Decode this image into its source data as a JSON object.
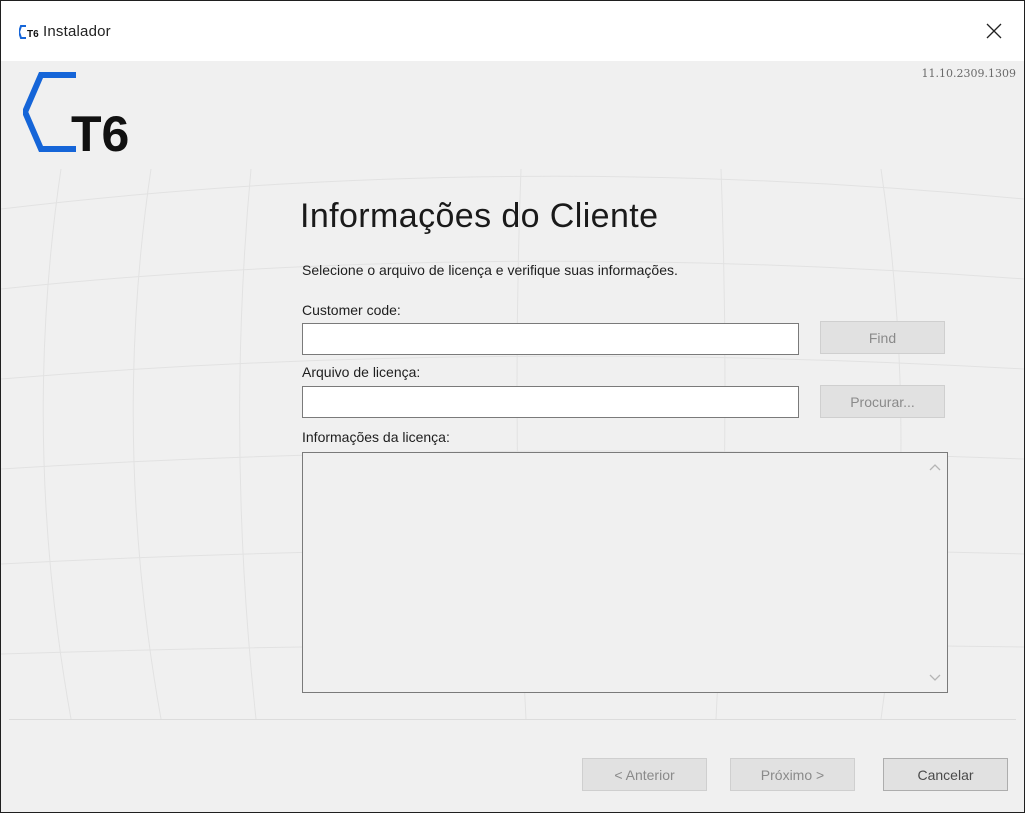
{
  "window": {
    "title": "Instalador",
    "version": "11.10.2309.1309",
    "brand": "T6"
  },
  "page": {
    "title": "Informações do Cliente",
    "subtitle": "Selecione o arquivo de licença e verifique suas informações."
  },
  "customer_code": {
    "label": "Customer code:",
    "value": "",
    "button": "Find"
  },
  "license_file": {
    "label": "Arquivo de licença:",
    "value": "",
    "button": "Procurar..."
  },
  "license_info": {
    "label": "Informações da licença:",
    "value": ""
  },
  "footer": {
    "back": "< Anterior",
    "next": "Próximo >",
    "cancel": "Cancelar"
  },
  "colors": {
    "brand_blue": "#1565d8",
    "brand_black": "#111111",
    "background": "#f0f0f0"
  },
  "icons": {
    "close": "close-icon",
    "app": "t6-app-icon",
    "scroll_up": "chevron-up-icon",
    "scroll_down": "chevron-down-icon"
  }
}
